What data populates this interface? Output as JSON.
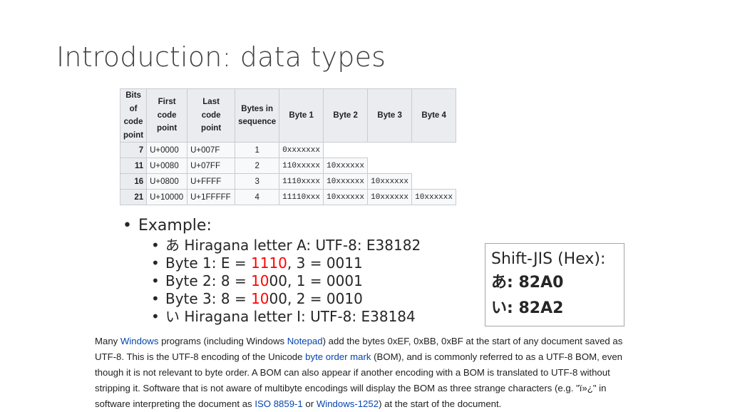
{
  "slide": {
    "title": "Introduction: data types"
  },
  "table": {
    "headers": {
      "bits": [
        "Bits",
        "of",
        "code",
        "point"
      ],
      "first": [
        "First",
        "code point"
      ],
      "last": [
        "Last",
        "code point"
      ],
      "bytes": [
        "Bytes in",
        "sequence"
      ],
      "b1": "Byte 1",
      "b2": "Byte 2",
      "b3": "Byte 3",
      "b4": "Byte 4"
    },
    "rows": [
      {
        "bits": "7",
        "first": "U+0000",
        "last": "U+007F",
        "bytes": "1",
        "b1": "0xxxxxxx",
        "b2": "",
        "b3": "",
        "b4": ""
      },
      {
        "bits": "11",
        "first": "U+0080",
        "last": "U+07FF",
        "bytes": "2",
        "b1": "110xxxxx",
        "b2": "10xxxxxx",
        "b3": "",
        "b4": ""
      },
      {
        "bits": "16",
        "first": "U+0800",
        "last": "U+FFFF",
        "bytes": "3",
        "b1": "1110xxxx",
        "b2": "10xxxxxx",
        "b3": "10xxxxxx",
        "b4": ""
      },
      {
        "bits": "21",
        "first": "U+10000",
        "last": "U+1FFFFF",
        "bytes": "4",
        "b1": "11110xxx",
        "b2": "10xxxxxx",
        "b3": "10xxxxxx",
        "b4": "10xxxxxx"
      }
    ]
  },
  "bullets": {
    "example": "Example:",
    "items": [
      {
        "prefix": "あ",
        "text": " Hiragana letter A: UTF-8: E38182"
      },
      {
        "pre": "Byte 1: E = ",
        "red": "1110",
        "post": ", 3 = 0011"
      },
      {
        "pre": "Byte 2: 8 = ",
        "red": "10",
        "post": "00, 1 = 0001"
      },
      {
        "pre": "Byte 3: 8 = ",
        "red": "10",
        "post": "00, 2 = 0010"
      },
      {
        "prefix": "い",
        "text": " Hiragana letter I: UTF-8: E38184"
      }
    ]
  },
  "sjis": {
    "title": "Shift-JIS (Hex):",
    "rows": [
      {
        "char": "あ",
        "code": ": 82A0"
      },
      {
        "char": "い",
        "code": ": 82A2"
      }
    ]
  },
  "paragraph": {
    "t1": "Many ",
    "l1": "Windows",
    "t2": " programs (including Windows ",
    "l2": "Notepad",
    "t3": ") add the bytes 0xEF, 0xBB, 0xBF at the start of any document saved as UTF-8. This is the UTF-8 encoding of the Unicode ",
    "l3": "byte order mark",
    "t4": " (BOM), and is commonly referred to as a UTF-8 BOM, even though it is not relevant to byte order. A BOM can also appear if another encoding with a BOM is translated to UTF-8 without stripping it. Software that is not aware of multibyte encodings will display the BOM as three strange characters (e.g. \"ï»¿\" in software interpreting the document as ",
    "l4": "ISO 8859-1",
    "t5": " or ",
    "l5": "Windows-1252",
    "t6": ") at the start of the document."
  },
  "colors": {
    "link": "#0645ad",
    "highlight": "#ff0000",
    "title": "#404040"
  }
}
